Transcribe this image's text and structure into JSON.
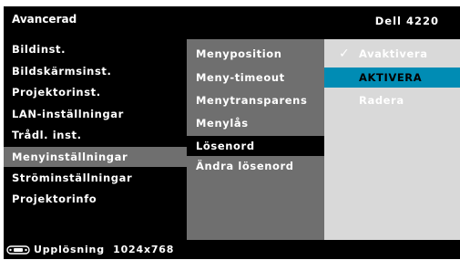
{
  "header": {
    "title": "Avancerad",
    "model": "Dell 4220"
  },
  "menu": {
    "items": [
      {
        "label": "Bildinst."
      },
      {
        "label": "Bildskärmsinst."
      },
      {
        "label": "Projektorinst."
      },
      {
        "label": "LAN-inställningar"
      },
      {
        "label": "Trådl. inst."
      },
      {
        "label": "Menyinställningar",
        "selected": true
      },
      {
        "label": "Ströminställningar"
      },
      {
        "label": "Projektorinfo"
      }
    ]
  },
  "submenu": {
    "items": [
      {
        "label": "Menyposition"
      },
      {
        "label": "Meny-timeout"
      },
      {
        "label": "Menytransparens"
      },
      {
        "label": "Menylås"
      },
      {
        "label": "Lösenord",
        "selected": true
      },
      {
        "label": "Ändra lösenord"
      }
    ]
  },
  "options": {
    "items": [
      {
        "label": "Avaktivera",
        "checked": true
      },
      {
        "label": "AKTIVERA",
        "highlighted": true
      },
      {
        "label": "Radera"
      }
    ]
  },
  "footer": {
    "label": "Upplösning",
    "resolution": "1024x768",
    "icon": "remote-control-icon"
  },
  "colors": {
    "background": "#000000",
    "submenu_bg": "#6f6f6f",
    "options_bg": "#d9d9d9",
    "accent": "#008cb4"
  }
}
